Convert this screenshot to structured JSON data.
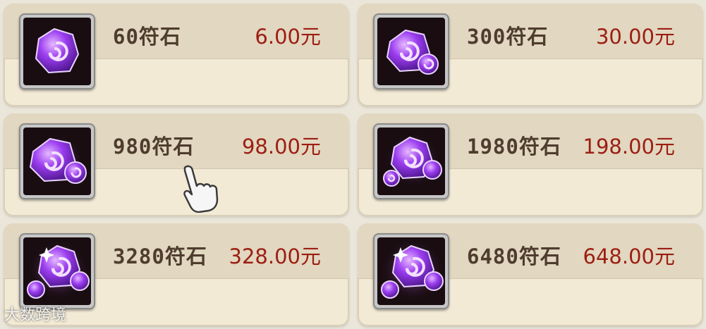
{
  "products": [
    {
      "name": "60符石",
      "price": "6.00元",
      "icon": "gem-small-icon"
    },
    {
      "name": "300符石",
      "price": "30.00元",
      "icon": "gem-pair-icon"
    },
    {
      "name": "980符石",
      "price": "98.00元",
      "icon": "gem-pair-icon"
    },
    {
      "name": "1980符石",
      "price": "198.00元",
      "icon": "gem-trio-icon"
    },
    {
      "name": "3280符石",
      "price": "328.00元",
      "icon": "gem-trio-glow-icon"
    },
    {
      "name": "6480符石",
      "price": "648.00元",
      "icon": "gem-trio-glow-icon"
    }
  ],
  "cursor_icon": "pointing-hand-icon",
  "watermark": "大数跨境",
  "colors": {
    "price": "#9c1e12",
    "name": "#4e3d2e",
    "gem": "#8a2be2"
  }
}
